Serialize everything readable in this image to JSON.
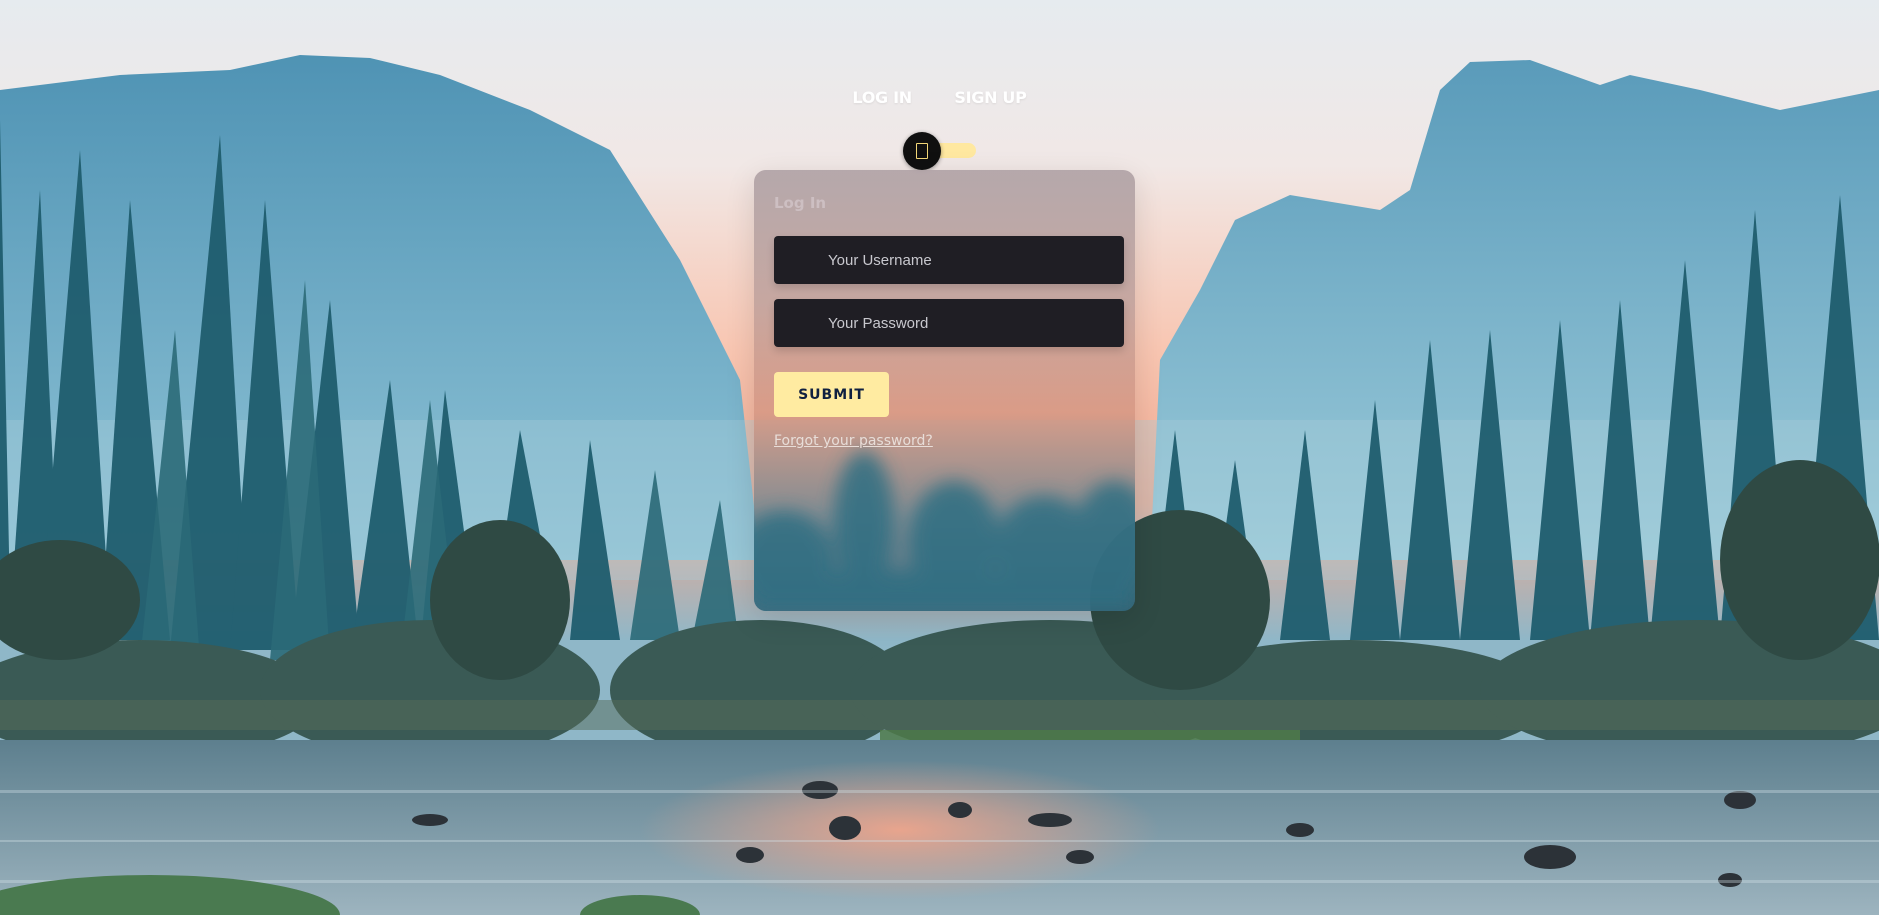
{
  "nav": {
    "login_tab": "LOG IN",
    "signup_tab": "SIGN UP"
  },
  "toggle": {
    "icon": "phone-outline-icon",
    "state": "login"
  },
  "form": {
    "title": "Log In",
    "username_placeholder": "Your Username",
    "password_placeholder": "Your Password",
    "submit_label": "SUBMIT",
    "forgot_label": "Forgot your password?"
  },
  "colors": {
    "accent": "#ffeba1",
    "field_bg": "#1f1e24",
    "toggle_knob": "#101010"
  }
}
